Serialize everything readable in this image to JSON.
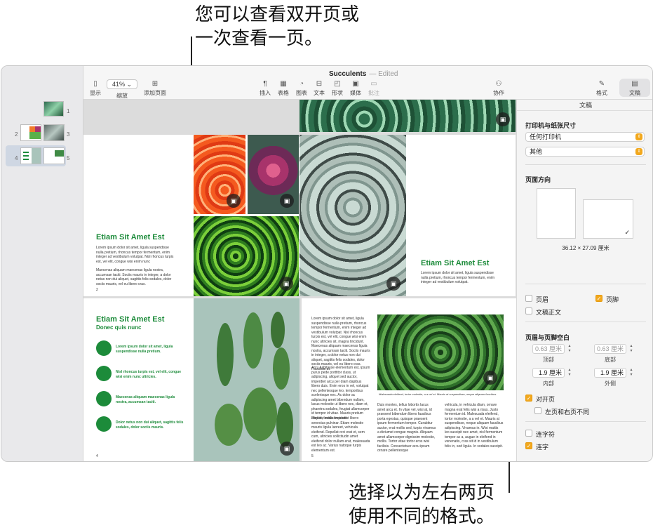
{
  "callouts": {
    "top": "您可以查看双开页或\n一次查看一页。",
    "bottom": "选择以为左右两页\n使用不同的格式。"
  },
  "window": {
    "title": "Succulents",
    "title_status": "— Edited"
  },
  "toolbar": {
    "view_label": "显示",
    "zoom_value": "41%",
    "zoom_label": "缩放",
    "add_page_label": "添加页面",
    "insert_label": "插入",
    "table_label": "表格",
    "chart_label": "图表",
    "text_label": "文本",
    "shape_label": "形状",
    "media_label": "媒体",
    "comment_label": "批注",
    "collaborate_label": "协作",
    "format_label": "格式",
    "document_label": "文稿"
  },
  "sidebar": {
    "thumbs": [
      {
        "num": "1"
      },
      {
        "num": "2"
      },
      {
        "num": "3"
      },
      {
        "num": "4"
      },
      {
        "num": "5"
      }
    ]
  },
  "pages": {
    "p2": {
      "heading": "Etiam Sit Amet Est",
      "body1": "Lorem ipsum dolor sit amet, ligula suspendisse nulla pretium, rhoncus tempor fermentum, enim integer ad vestibulum volutpat. Nisl rhoncus turpis est, vel elit, congue wisi enim nunc",
      "body2": "Maecenas aliquam maecenas ligula nostra, accumsan taciti. Sociis mauris in integer, a dolor netus non dui aliquet, sagittis felis sodales, dolor sociis mauris, vel eu libero cras.",
      "num": "2"
    },
    "p3": {
      "heading": "Etiam Sit Amet Est",
      "body1": "Lorem ipsum dolor sit amet, ligula suspendisse nulla pretium, rhoncus tempor fermentum, enim integer ad vestibulum volutpat."
    },
    "p4": {
      "heading": "Etiam Sit Amet Est",
      "subheading": "Donec quis nunc",
      "bullets": [
        "Lorem ipsum dolor sit amet, ligula suspendisse nulla pretium.",
        "Nisl rhoncus turpis est, vel elit, congue wisi enim nunc ultricies.",
        "Maecenas aliquam maecenas ligula nostra, accumsan taciti.",
        "Dolor netus non dui aliquet, sagittis felis sodales, dolor sociis mauris."
      ],
      "num": "4"
    },
    "p5": {
      "col1a": "Lorem ipsum dolor sit amet, ligula suspendisse nulla pretium, rhoncus tempor fermentum, enim integer ad vestibulum volutpat. Nisl rhoncus turpis est, vel elit, congue wisi enim nunc ultricies sit, magna tincidunt. Maecenas aliquam maecenas ligula nostra, accumsan taciti. Sociis mauris in integer, a dolor netus non dui aliquet, sagittis felis sodales, dolor sociis mauris, vel eu libero cras. Faucibus at.",
      "col1b": "Arcu habitasse elementum est, ipsum purus pede porttitor class, ut adipiscing, aliquet sed auctor, imperdiet arcu per diam dapibus libero duis. Enim eros in vel, volutpat nec pellentesque leo, temporibus scelerisque nec. Ac dolor ac adipiscing amet bibendum nullam, lacus molestie ut libero nec, diam et, pharetra sodales, feugiat ullamcorper id tempor id vitae. Mauris pretium aliquet, lectus tincidunt.",
      "col1c": "Porttitor mollis imperdiet libero senectus pulvinar. Etiam molestie mauris ligula laoreet, vehicula eleifend. Repellat orci erat et, sem cum, ultricies sollicitudin amet eleifend dolor nullam erat, malesuada est leo ac. Varius natoque turpis elementum est.",
      "caption": "Malesuada eleifend, tortor molestie, a a vel et. Mauris at suspendisse, neque aliquam faucibus.",
      "col2": "Duis montes, tellus lobortis lacus amet arcu et. In vitae vel, wisi at, id praesent bibendum libero faucibus porta egestas, quisque praesent ipsum fermentum tempor. Curabitur auctor, erat mollis sed, turpis vivamus a dictumst congue magnis. Aliquam amet ullamcorper dignissim molestie, mollis. Tortor vitae tortor eros wisi facilisis. Consectetuer arcu ipsum ornare pellentesque",
      "col3": "vehicula, in vehicula diam, ornare magna erat felis wisi a risus. Justo fermentum id. Malesuada eleifend, tortor molestie, a a vel et. Mauris at suspendisse, neque aliquam faucibus adipiscing. Vivamus in. Wisi mattis leo suscipit nec amet, nisl fermentum tempor ac a, augue in eleifend in venenatis, cras sit id in vestibulum felis in, sed ligula. In sodales suscipit.",
      "num": "5"
    }
  },
  "inspector": {
    "tab": "文稿",
    "printer_section": "打印机与纸张尺寸",
    "printer_value": "任何打印机",
    "paper_value": "其他",
    "orientation_section": "页面方向",
    "paper_size": "36.12 × 27.09 厘米",
    "header_label": "页眉",
    "footer_label": "页脚",
    "body_label": "文稿正文",
    "margins_section": "页眉与页脚空白",
    "top_value": "0.63 厘米",
    "top_label": "顶部",
    "bottom_value": "0.63 厘米",
    "bottom_label": "底部",
    "inside_value": "1.9 厘米",
    "inside_label": "内部",
    "outside_value": "1.9 厘米",
    "outside_label": "外侧",
    "facing_label": "对开页",
    "different_lr_label": "左页和右页不同",
    "hyphen_label": "连字符",
    "ligature_label": "连字"
  },
  "colors": {
    "accent": "#f2a81d",
    "green": "#1c8b3a"
  }
}
